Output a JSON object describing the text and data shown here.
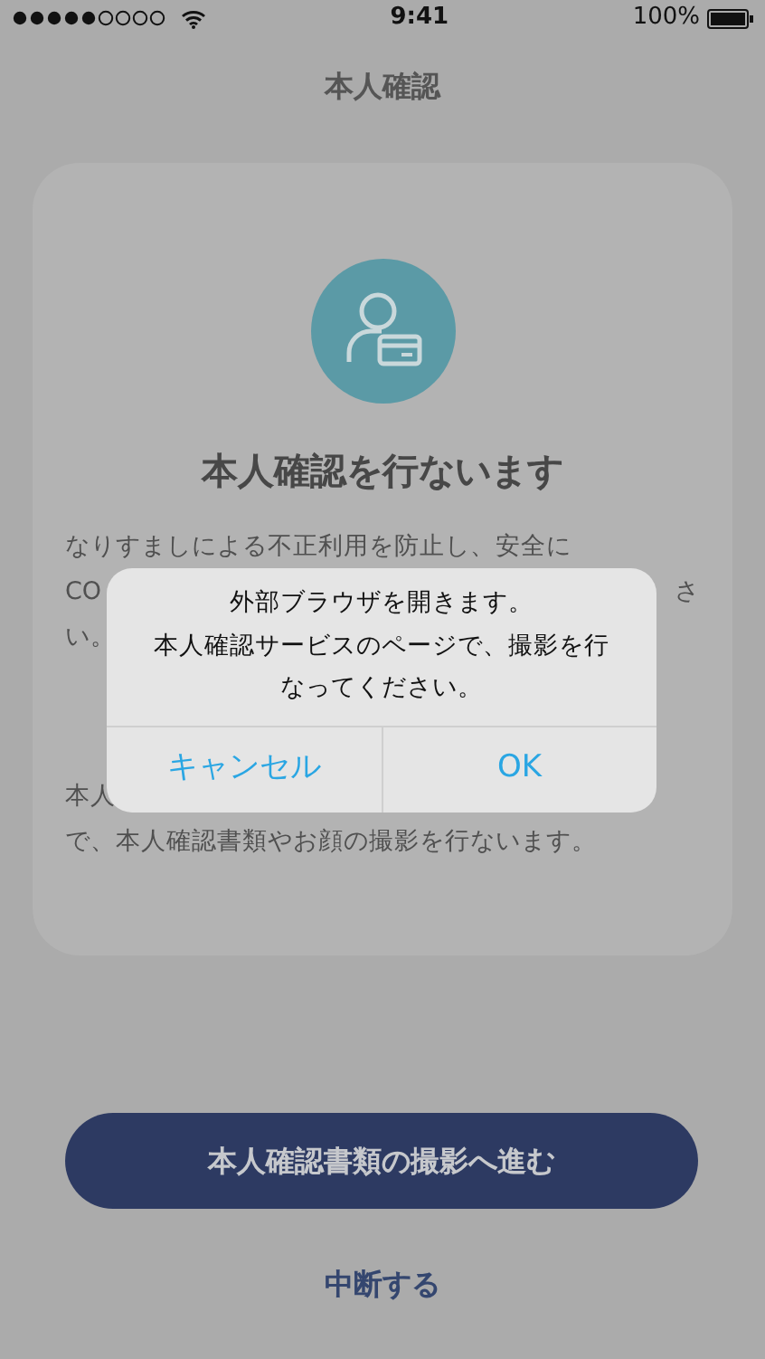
{
  "status_bar": {
    "time": "9:41",
    "battery": "100%"
  },
  "nav": {
    "title": "本人確認"
  },
  "card": {
    "heading": "本人確認を行ないます",
    "paragraphs": [
      [
        {
          "left": "なりすましによる不正利用を防止し、安全に"
        },
        {
          "left": "CO",
          "right": "さ"
        },
        {
          "left": "い。"
        }
      ],
      [
        {
          "left": "本人"
        },
        {
          "left": "で、本人確認書類やお顔の撮影を行ないます。"
        }
      ]
    ]
  },
  "primary_button": "本人確認書類の撮影へ進む",
  "secondary_link": "中断する",
  "dialog": {
    "message_lines": [
      "外部ブラウザを開きます。",
      "本人確認サービスのページで、撮影を行なってください。"
    ],
    "buttons": [
      {
        "label": "キャンセル"
      },
      {
        "label": "OK"
      }
    ]
  }
}
